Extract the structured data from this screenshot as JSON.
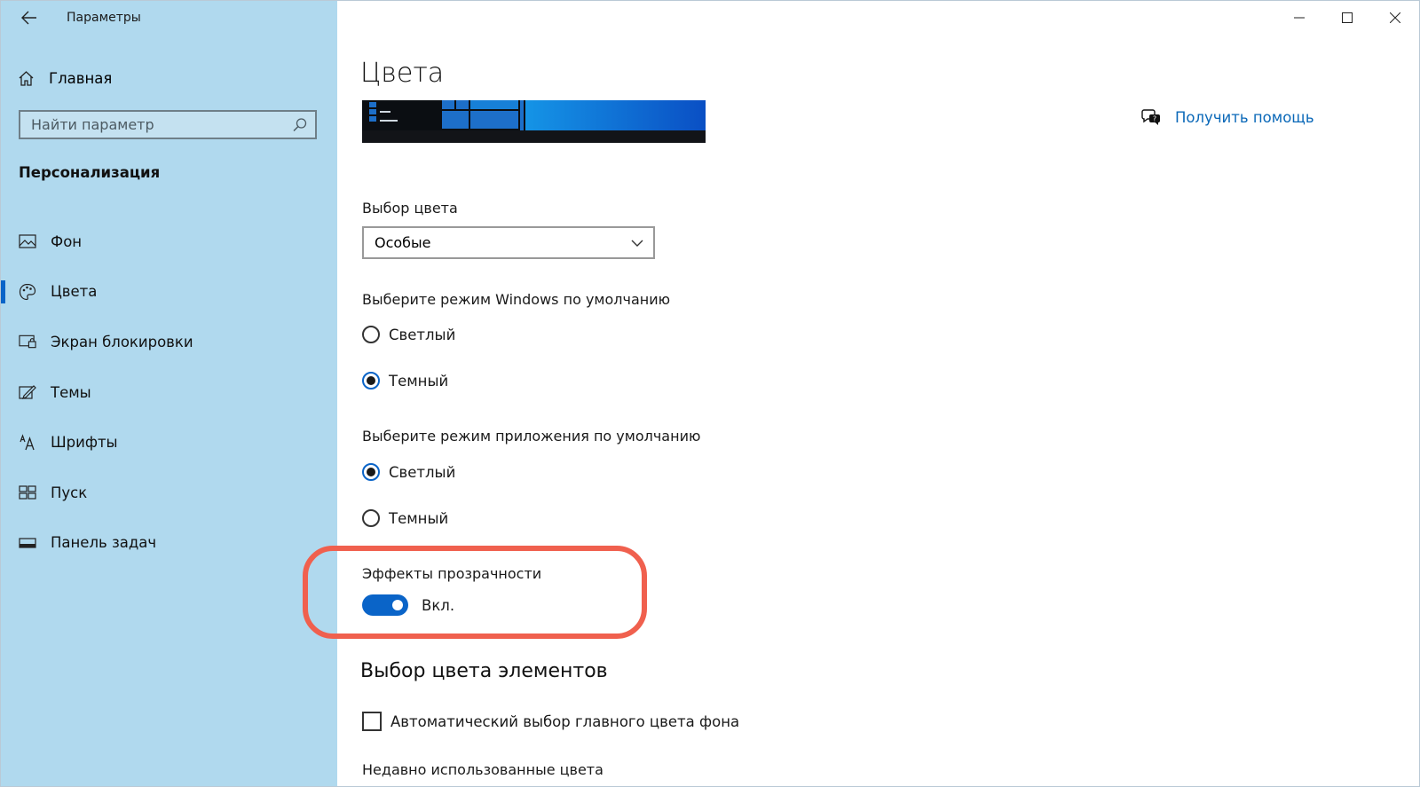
{
  "window": {
    "title": "Параметры",
    "controls": [
      "minimize-icon",
      "maximize-icon",
      "close-icon"
    ]
  },
  "sidebar": {
    "home_label": "Главная",
    "search_placeholder": "Найти параметр",
    "section_title": "Персонализация",
    "items": [
      {
        "label": "Фон",
        "icon": "image-icon",
        "active": false
      },
      {
        "label": "Цвета",
        "icon": "palette-icon",
        "active": true
      },
      {
        "label": "Экран блокировки",
        "icon": "lock-screen-icon",
        "active": false
      },
      {
        "label": "Темы",
        "icon": "themes-icon",
        "active": false
      },
      {
        "label": "Шрифты",
        "icon": "fonts-icon",
        "active": false
      },
      {
        "label": "Пуск",
        "icon": "start-icon",
        "active": false
      },
      {
        "label": "Панель задач",
        "icon": "taskbar-icon",
        "active": false
      }
    ]
  },
  "main": {
    "title": "Цвета",
    "help_link": "Получить помощь",
    "color_choice_label": "Выбор цвета",
    "color_choice_value": "Особые",
    "windows_mode_label": "Выберите режим Windows по умолчанию",
    "windows_mode_options": [
      {
        "label": "Светлый",
        "checked": false
      },
      {
        "label": "Темный",
        "checked": true
      }
    ],
    "app_mode_label": "Выберите режим приложения по умолчанию",
    "app_mode_options": [
      {
        "label": "Светлый",
        "checked": true
      },
      {
        "label": "Темный",
        "checked": false
      }
    ],
    "transparency_label": "Эффекты прозрачности",
    "transparency_state": "Вкл.",
    "accent_heading": "Выбор цвета элементов",
    "auto_accent_label": "Автоматический выбор главного цвета фона",
    "recent_colors_label": "Недавно использованные цвета"
  },
  "colors": {
    "sidebar_bg": "#b0d9ee",
    "accent": "#0a64c8",
    "highlight": "#f0604e",
    "link": "#0a68b8"
  }
}
